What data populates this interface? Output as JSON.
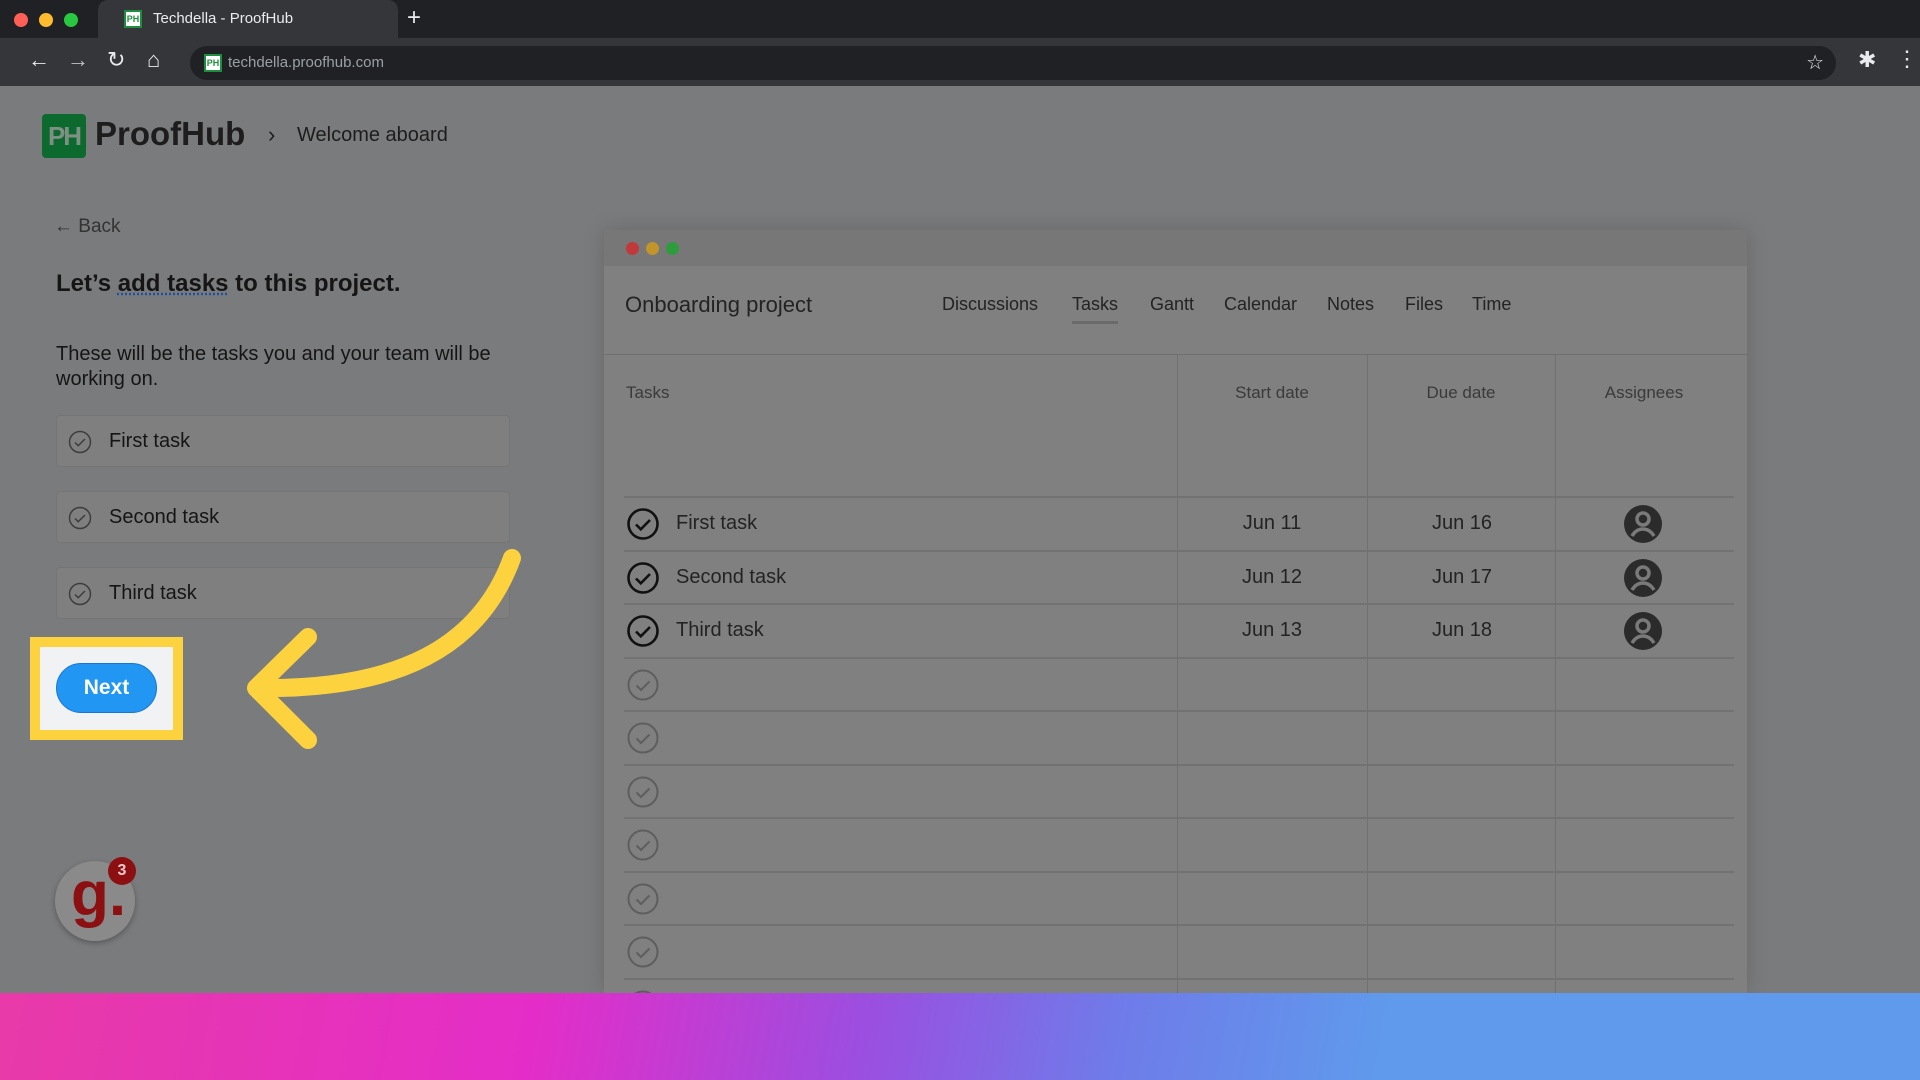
{
  "browser": {
    "tab_title": "Techdella - ProofHub",
    "favicon_text": "PH",
    "url": "techdella.proofhub.com",
    "new_tab_icon": "plus-icon",
    "nav_icons": [
      "back-arrow-icon",
      "forward-arrow-icon",
      "reload-icon",
      "home-icon"
    ],
    "right_icons": [
      "star-icon",
      "puzzle-extension-icon",
      "kebab-menu-icon"
    ]
  },
  "header": {
    "logo_text": "PH",
    "brand": "ProofHub",
    "breadcrumb_separator": ">",
    "breadcrumb": "Welcome aboard"
  },
  "onboarding": {
    "back_label": "Back",
    "heading_prefix": "Let’s ",
    "heading_underlined": "add tasks",
    "heading_suffix": " to this project.",
    "description": "These will be the tasks you and your team will be working on.",
    "task_inputs": [
      {
        "value": "First task"
      },
      {
        "value": "Second task"
      },
      {
        "value": "Third task"
      }
    ],
    "next_label": "Next",
    "highlight_color": "#fdd23f",
    "button_color": "#2196f3"
  },
  "widget": {
    "letter": "g.",
    "badge_count": "3"
  },
  "preview": {
    "project_title": "Onboarding project",
    "tabs": [
      {
        "label": "Discussions",
        "active": false
      },
      {
        "label": "Tasks",
        "active": true
      },
      {
        "label": "Gantt",
        "active": false
      },
      {
        "label": "Calendar",
        "active": false
      },
      {
        "label": "Notes",
        "active": false
      },
      {
        "label": "Files",
        "active": false
      },
      {
        "label": "Time",
        "active": false
      }
    ],
    "columns": [
      "Tasks",
      "Start date",
      "Due date",
      "Assignees"
    ],
    "rows": [
      {
        "task": "First task",
        "start": "Jun 11",
        "due": "Jun 16",
        "assignee": "user-avatar-icon"
      },
      {
        "task": "Second task",
        "start": "Jun 12",
        "due": "Jun 17",
        "assignee": "user-avatar-icon"
      },
      {
        "task": "Third task",
        "start": "Jun 13",
        "due": "Jun 18",
        "assignee": "user-avatar-icon"
      }
    ],
    "empty_rows": 8
  }
}
